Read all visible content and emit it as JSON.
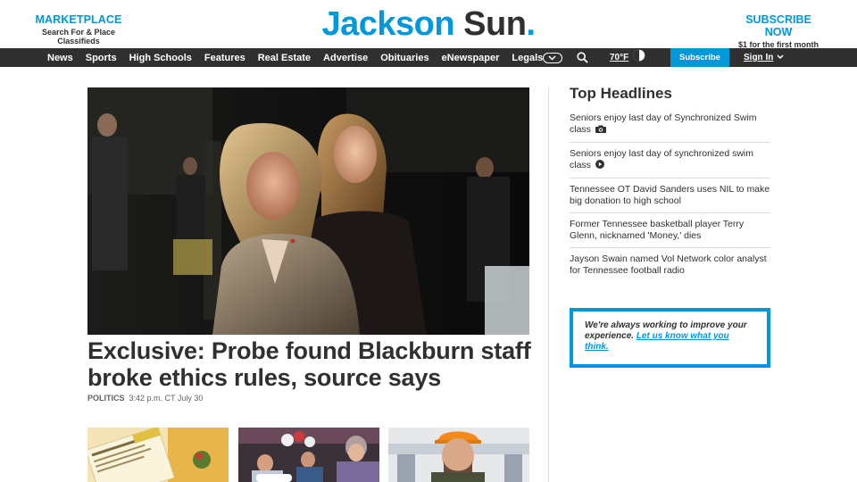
{
  "masthead": {
    "marketplace_title": "MARKETPLACE",
    "marketplace_sub": "Search For & Place Classifieds",
    "logo_word1": "Jackson",
    "logo_word2": "Sun",
    "logo_dot": ".",
    "subscribe_title": "SUBSCRIBE NOW",
    "subscribe_sub": "$1 for the first month"
  },
  "nav": {
    "items": [
      "News",
      "Sports",
      "High Schools",
      "Features",
      "Real Estate",
      "Advertise",
      "Obituaries",
      "eNewspaper",
      "Legals"
    ],
    "temperature": "70°F",
    "subscribe_label": "Subscribe",
    "signin_label": "Sign In"
  },
  "hero": {
    "title": "Exclusive: Probe found Blackburn staff broke ethics rules, source says",
    "category": "POLITICS",
    "timestamp": "3:42 p.m. CT July 30"
  },
  "sidebar": {
    "title": "Top Headlines",
    "headlines": [
      {
        "text": "Seniors enjoy last day of Synchronized Swim class",
        "icon": "camera-icon"
      },
      {
        "text": "Seniors enjoy last day of synchronized swim class",
        "icon": "play-icon"
      },
      {
        "text": "Tennessee OT David Sanders uses NIL to make big donation to high school",
        "icon": ""
      },
      {
        "text": "Former Tennessee basketball player Terry Glenn, nicknamed 'Money,' dies",
        "icon": ""
      },
      {
        "text": "Jayson Swain named Vol Network color analyst for Tennessee football radio",
        "icon": ""
      }
    ],
    "feedback_text": "We're always working to improve your experience.",
    "feedback_link": "Let us know what you think."
  },
  "colors": {
    "brand_blue": "#0098db",
    "nav_bg": "#303030",
    "text": "#303030"
  }
}
